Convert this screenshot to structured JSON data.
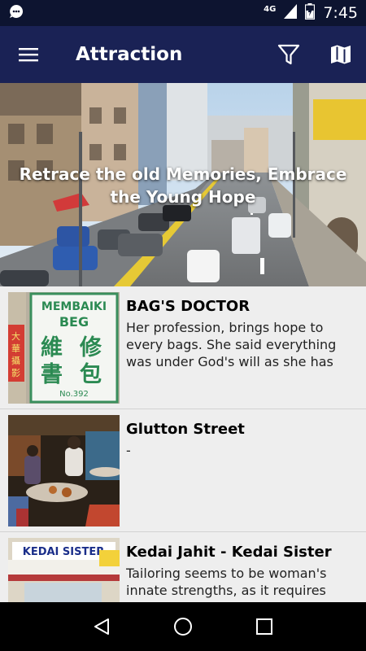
{
  "status_bar": {
    "network_label": "4G",
    "time": "7:45",
    "icons": [
      "notification-icon",
      "signal-icon",
      "battery-icon"
    ]
  },
  "app_bar": {
    "title": "Attraction",
    "icons": [
      "menu-icon",
      "filter-icon",
      "map-icon"
    ]
  },
  "hero": {
    "caption": "Retrace the old Memories, Embrace the Young Hope"
  },
  "list": {
    "items": [
      {
        "title": "BAG'S DOCTOR",
        "description": "Her profession, brings hope to every bags. She said everything was under God's will as she has been operating",
        "thumb_sign_line1": "MEMBAIKI",
        "thumb_sign_line2": "BEG",
        "thumb_sign_line3": "No.392"
      },
      {
        "title": "Glutton Street",
        "description": "-"
      },
      {
        "title": "Kedai Jahit - Kedai Sister",
        "description": "Tailoring seems to be woman's innate strengths, as it requires",
        "thumb_sign_line1": "KEDAI SISTER"
      }
    ]
  },
  "nav_bar": {
    "icons": [
      "back-icon",
      "home-icon",
      "recents-icon"
    ]
  },
  "colors": {
    "status_bar": "#0d1430",
    "app_bar": "#1a2255",
    "list_background": "#eeeeee",
    "nav_bar": "#000000"
  }
}
